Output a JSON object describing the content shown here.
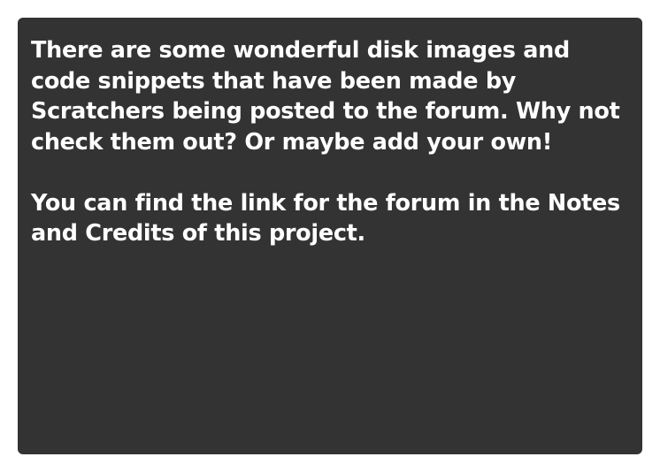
{
  "dialog": {
    "background": "#333333",
    "text_color": "#ffffff",
    "paragraphs": [
      "There are some wonderful disk images and code snippets that have been made by Scratchers being posted to the forum. Why not check them out? Or maybe add your own!",
      "You can find the link for the forum in the Notes and Credits of this project."
    ]
  }
}
